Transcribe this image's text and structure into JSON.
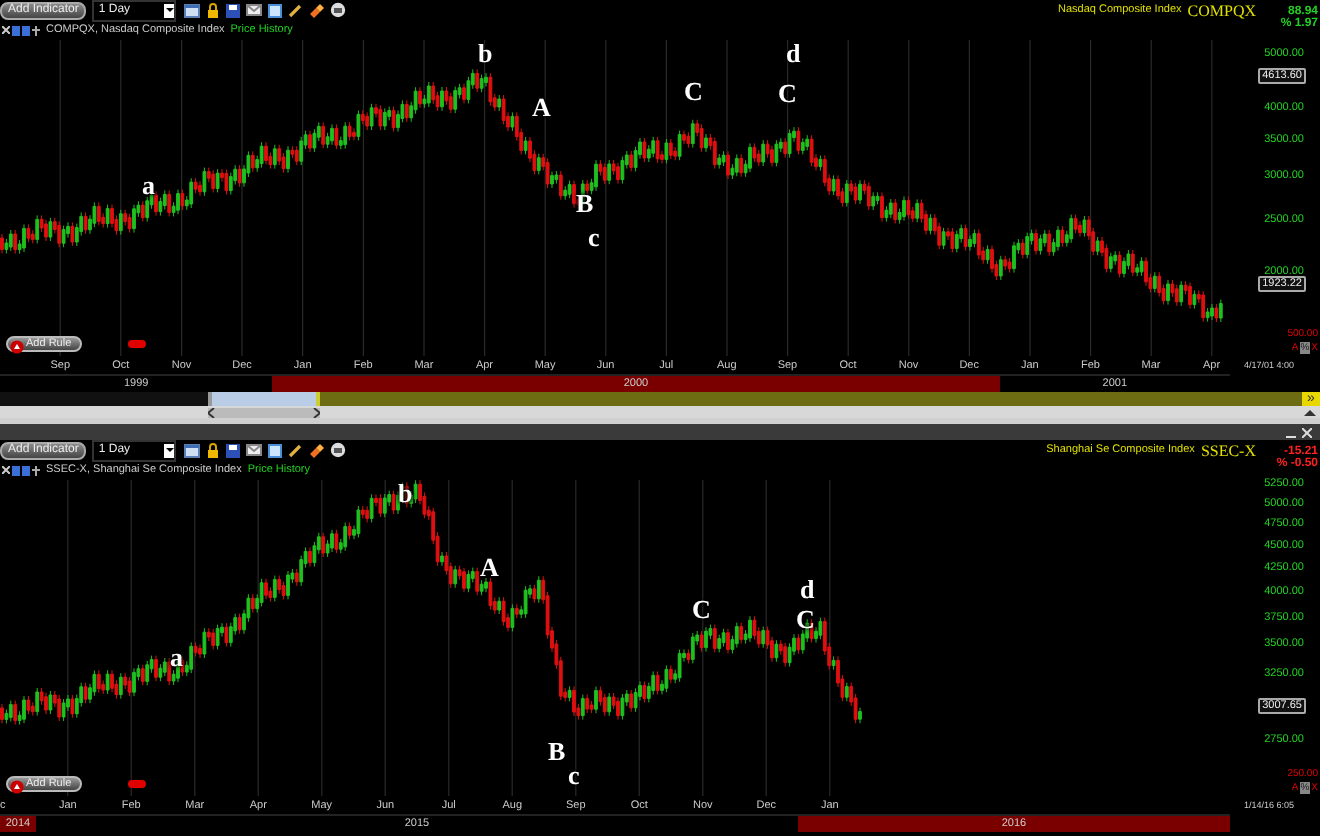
{
  "panels": [
    {
      "add_button": "Add Indicator",
      "interval": "1 Day",
      "symbol_title": "COMPQX, Nasdaq Composite Index",
      "view_label": "Price History",
      "index_name": "Nasdaq Composite Index",
      "symbol": "COMPQX",
      "change": "88.94",
      "change_percent": "% 1.97",
      "color": "#22d022",
      "price_axis": [
        {
          "label": "5000.00",
          "boxed": false
        },
        {
          "label": "4613.60",
          "boxed": true
        },
        {
          "label": "4000.00",
          "boxed": false
        },
        {
          "label": "3500.00",
          "boxed": false
        },
        {
          "label": "3000.00",
          "boxed": false
        },
        {
          "label": "2500.00",
          "boxed": false
        },
        {
          "label": "2000.00",
          "boxed": false
        },
        {
          "label": "1923.22",
          "boxed": true
        }
      ],
      "annotations": [
        "a",
        "b",
        "A",
        "B",
        "c",
        "C",
        "d",
        "C"
      ],
      "rule_button": "Add Rule",
      "volume_scale": "500.00",
      "scale_buttons": [
        "A",
        "%",
        "X"
      ],
      "timestamp": "4/17/01 4:00",
      "years": [
        {
          "label": "1999",
          "highlighted": false,
          "months": [
            "Sep",
            "Oct",
            "Nov",
            "Dec"
          ]
        },
        {
          "label": "2000",
          "highlighted": true,
          "months": [
            "Jan",
            "Feb",
            "Mar",
            "Apr",
            "May",
            "Jun",
            "Jul",
            "Aug",
            "Sep",
            "Oct",
            "Nov",
            "Dec"
          ]
        },
        {
          "label": "2001",
          "highlighted": false,
          "months": [
            "Jan",
            "Feb",
            "Mar",
            "Apr"
          ]
        }
      ]
    },
    {
      "add_button": "Add Indicator",
      "interval": "1 Day",
      "symbol_title": "SSEC-X, Shanghai Se Composite Index",
      "view_label": "Price History",
      "index_name": "Shanghai Se Composite Index",
      "symbol": "SSEC-X",
      "change": "-15.21",
      "change_percent": "% -0.50",
      "color": "#ff2020",
      "price_axis": [
        {
          "label": "5250.00",
          "boxed": false
        },
        {
          "label": "5000.00",
          "boxed": false
        },
        {
          "label": "4750.00",
          "boxed": false
        },
        {
          "label": "4500.00",
          "boxed": false
        },
        {
          "label": "4250.00",
          "boxed": false
        },
        {
          "label": "4000.00",
          "boxed": false
        },
        {
          "label": "3750.00",
          "boxed": false
        },
        {
          "label": "3500.00",
          "boxed": false
        },
        {
          "label": "3250.00",
          "boxed": false
        },
        {
          "label": "3007.65",
          "boxed": true
        },
        {
          "label": "2750.00",
          "boxed": false
        }
      ],
      "annotations": [
        "b",
        "A",
        "a",
        "C",
        "d",
        "C",
        "B",
        "c"
      ],
      "rule_button": "Add Rule",
      "volume_scale": "250.00",
      "scale_buttons": [
        "A",
        "%",
        "X"
      ],
      "timestamp": "1/14/16 6:05",
      "years": [
        {
          "label": "2014",
          "highlighted": true,
          "months": [
            "c"
          ]
        },
        {
          "label": "2015",
          "highlighted": false,
          "months": [
            "Jan",
            "Feb",
            "Mar",
            "Apr",
            "May",
            "Jun",
            "Jul",
            "Aug",
            "Sep",
            "Oct",
            "Nov",
            "Dec"
          ]
        },
        {
          "label": "2016",
          "highlighted": true,
          "months": [
            "Jan"
          ]
        }
      ]
    }
  ],
  "scroller": {
    "end_button": "»"
  }
}
